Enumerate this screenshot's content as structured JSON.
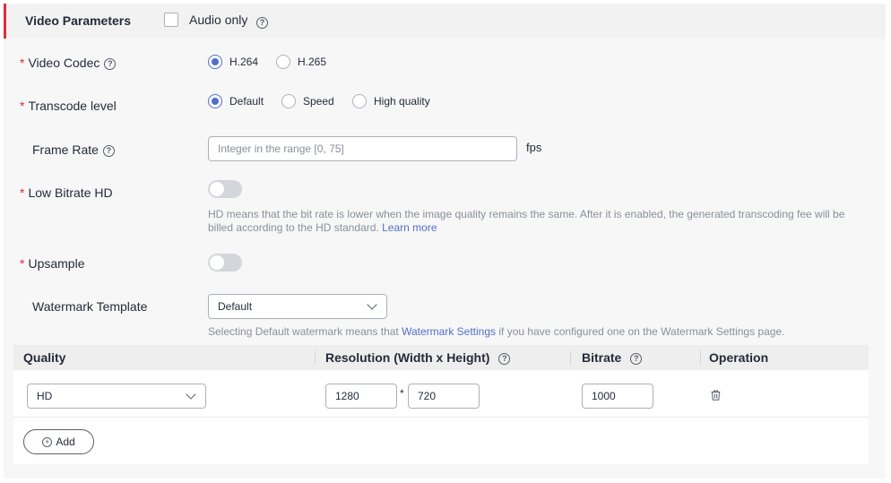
{
  "header": {
    "title": "Video Parameters",
    "audio_only_label": "Audio only",
    "audio_only_checked": false
  },
  "video_codec": {
    "label": "Video Codec",
    "required": "*",
    "options": [
      "H.264",
      "H.265"
    ],
    "selected": "H.264"
  },
  "transcode_level": {
    "label": "Transcode level",
    "required": "*",
    "options": [
      "Default",
      "Speed",
      "High quality"
    ],
    "selected": "Default"
  },
  "frame_rate": {
    "label": "Frame Rate",
    "placeholder": "Integer in the range [0, 75]",
    "value": "",
    "unit": "fps"
  },
  "low_bitrate_hd": {
    "label": "Low Bitrate HD",
    "required": "*",
    "enabled": false,
    "hint": "HD means that the bit rate is lower when the image quality remains the same. After it is enabled, the generated transcoding fee will be billed according to the HD standard.",
    "hint_link": "Learn more"
  },
  "upsample": {
    "label": "Upsample",
    "required": "*",
    "enabled": false
  },
  "watermark_template": {
    "label": "Watermark Template",
    "selected": "Default",
    "hint_prefix": "Selecting Default watermark means that",
    "hint_link": "Watermark Settings",
    "hint_suffix": "if you have configured one on the Watermark Settings page."
  },
  "table": {
    "columns": [
      "Quality",
      "Resolution (Width x Height)",
      "Bitrate",
      "Operation"
    ],
    "rows": [
      {
        "quality": "HD",
        "width": "1280",
        "separator": "*",
        "height": "720",
        "bitrate": "1000"
      }
    ],
    "add_label": "Add"
  },
  "colors": {
    "accent": "#526ecc",
    "required": "#e02c37",
    "section_bar": "#e02c37"
  }
}
